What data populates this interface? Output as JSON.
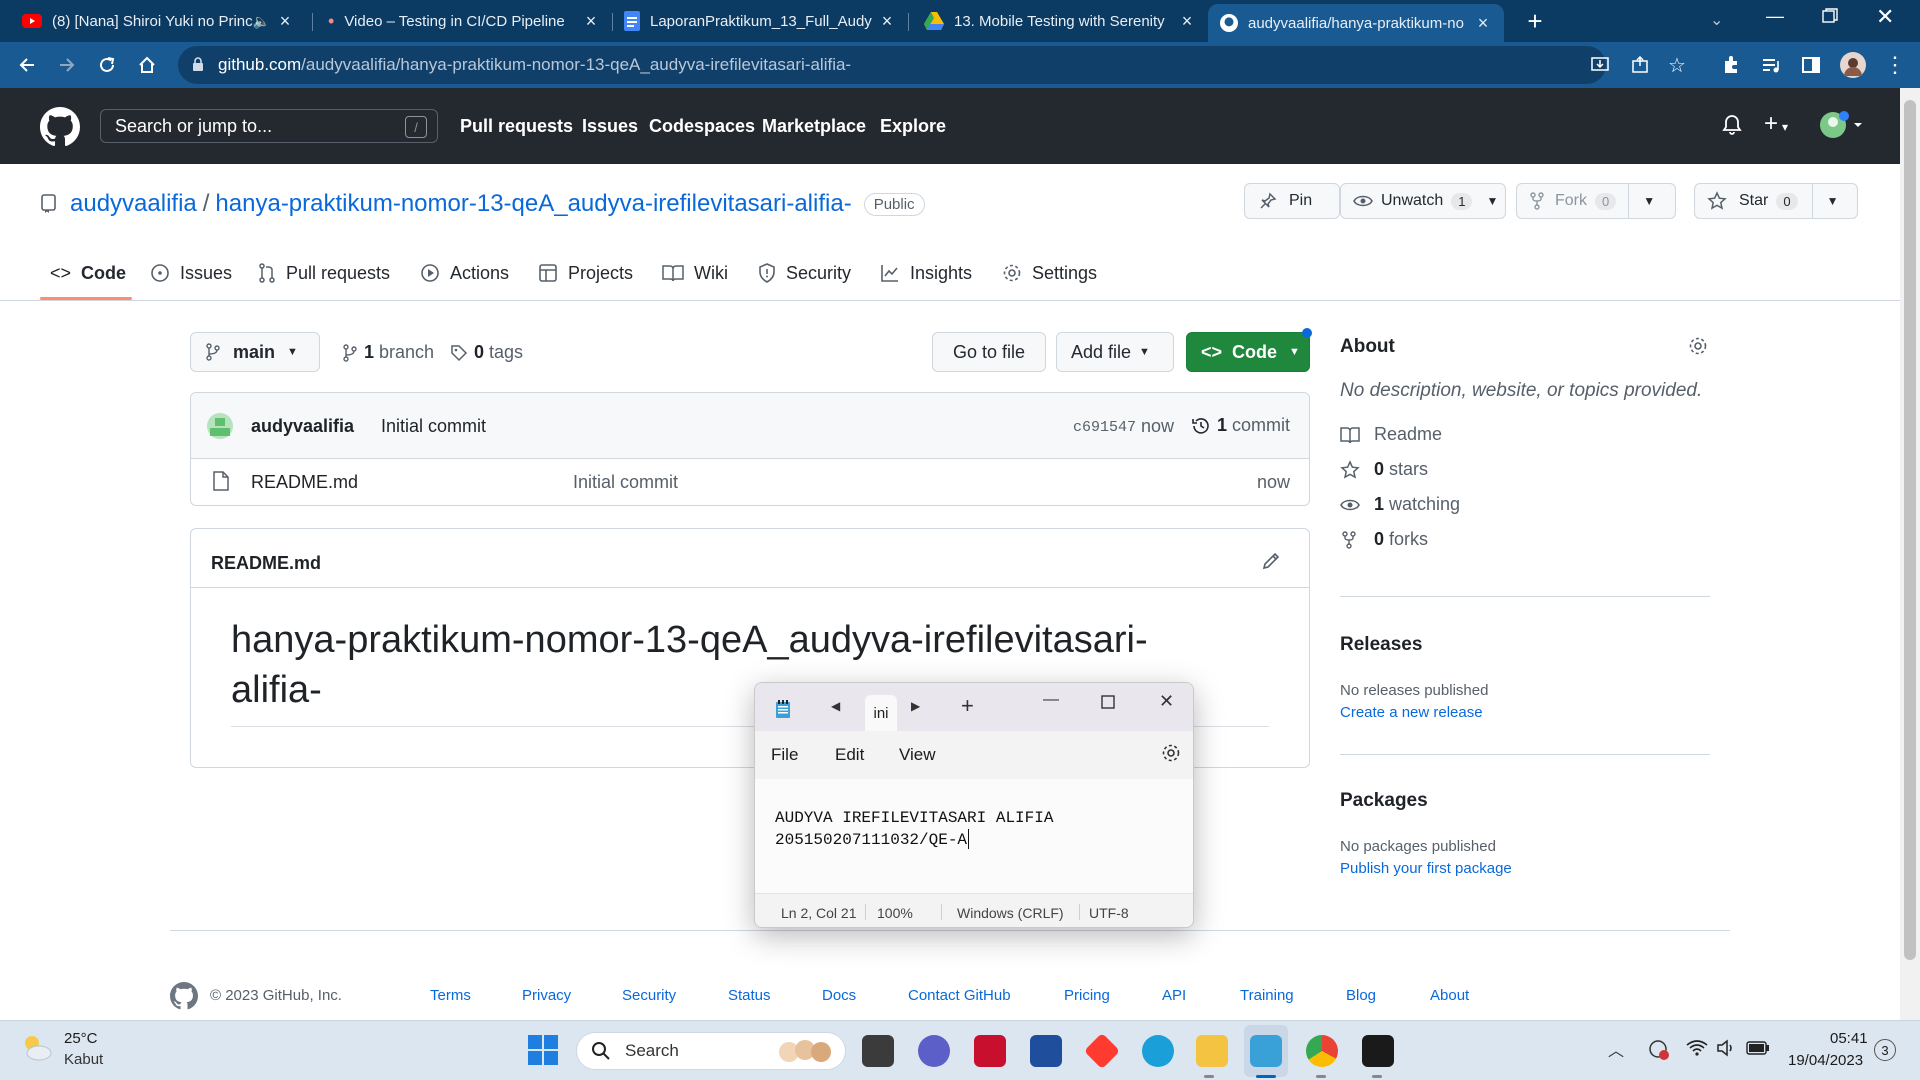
{
  "browser": {
    "tabs": [
      {
        "title": "(8) [Nana] Shiroi Yuki no Princ",
        "icon": "youtube-icon"
      },
      {
        "title": "Video – Testing in CI/CD Pipeline",
        "icon": "dot-icon"
      },
      {
        "title": "LaporanPraktikum_13_Full_Audyv",
        "icon": "docs-icon"
      },
      {
        "title": "13. Mobile Testing with Serenity",
        "icon": "drive-icon"
      },
      {
        "title": "audyvaalifia/hanya-praktikum-no",
        "icon": "github-icon"
      }
    ],
    "url_host": "github.com",
    "url_path": "/audyvaalifia/hanya-praktikum-nomor-13-qeA_audyva-irefilevitasari-alifia-"
  },
  "gh": {
    "search_placeholder": "Search or jump to...",
    "search_key": "/",
    "nav": [
      "Pull requests",
      "Issues",
      "Codespaces",
      "Marketplace",
      "Explore"
    ]
  },
  "repo": {
    "owner": "audyvaalifia",
    "sep": "/",
    "name": "hanya-praktikum-nomor-13-qeA_audyva-irefilevitasari-alifia-",
    "visibility": "Public",
    "pin": "Pin",
    "unwatch": "Unwatch",
    "watch_count": "1",
    "fork": "Fork",
    "fork_count": "0",
    "star": "Star",
    "star_count": "0",
    "tabs": [
      "Code",
      "Issues",
      "Pull requests",
      "Actions",
      "Projects",
      "Wiki",
      "Security",
      "Insights",
      "Settings"
    ]
  },
  "branchbar": {
    "branch": "main",
    "branch_count": "1",
    "branch_word": "branch",
    "tag_count": "0",
    "tag_word": "tags",
    "goto": "Go to file",
    "add": "Add file",
    "code": "Code"
  },
  "commit": {
    "author": "audyvaalifia",
    "message": "Initial commit",
    "sha": "c691547",
    "time": "now",
    "count": "1",
    "count_word": "commit",
    "files": [
      {
        "name": "README.md",
        "message": "Initial commit",
        "time": "now"
      }
    ]
  },
  "readme": {
    "filename": "README.md",
    "heading_line1": "hanya-praktikum-nomor-13-qeA_audyva-irefilevitasari-",
    "heading_line2": "alifia-"
  },
  "about": {
    "title": "About",
    "description": "No description, website, or topics provided.",
    "items": [
      {
        "label": "Readme",
        "icon": "book-icon"
      },
      {
        "count": "0",
        "label": "stars",
        "icon": "star-icon"
      },
      {
        "count": "1",
        "label": "watching",
        "icon": "eye-icon"
      },
      {
        "count": "0",
        "label": "forks",
        "icon": "fork-icon"
      }
    ],
    "releases_title": "Releases",
    "releases_none": "No releases published",
    "releases_link": "Create a new release",
    "packages_title": "Packages",
    "packages_none": "No packages published",
    "packages_link": "Publish your first package"
  },
  "footer": {
    "copyright": "© 2023 GitHub, Inc.",
    "links": [
      "Terms",
      "Privacy",
      "Security",
      "Status",
      "Docs",
      "Contact GitHub",
      "Pricing",
      "API",
      "Training",
      "Blog",
      "About"
    ]
  },
  "notepad": {
    "tab": "ini",
    "menu": [
      "File",
      "Edit",
      "View"
    ],
    "line1": "AUDYVA IREFILEVITASARI ALIFIA",
    "line2": "205150207111032/QE-A",
    "status_pos": "Ln 2, Col 21",
    "status_zoom": "100%",
    "status_eol": "Windows (CRLF)",
    "status_enc": "UTF-8"
  },
  "taskbar": {
    "weather_temp": "25°C",
    "weather_desc": "Kabut",
    "search": "Search",
    "time": "05:41",
    "date": "19/04/2023",
    "notif_count": "3"
  },
  "colors": {
    "accent": "#0969da",
    "github_header": "#24292f",
    "code_button": "#1f883d",
    "tab_underline": "#fd8c73"
  }
}
